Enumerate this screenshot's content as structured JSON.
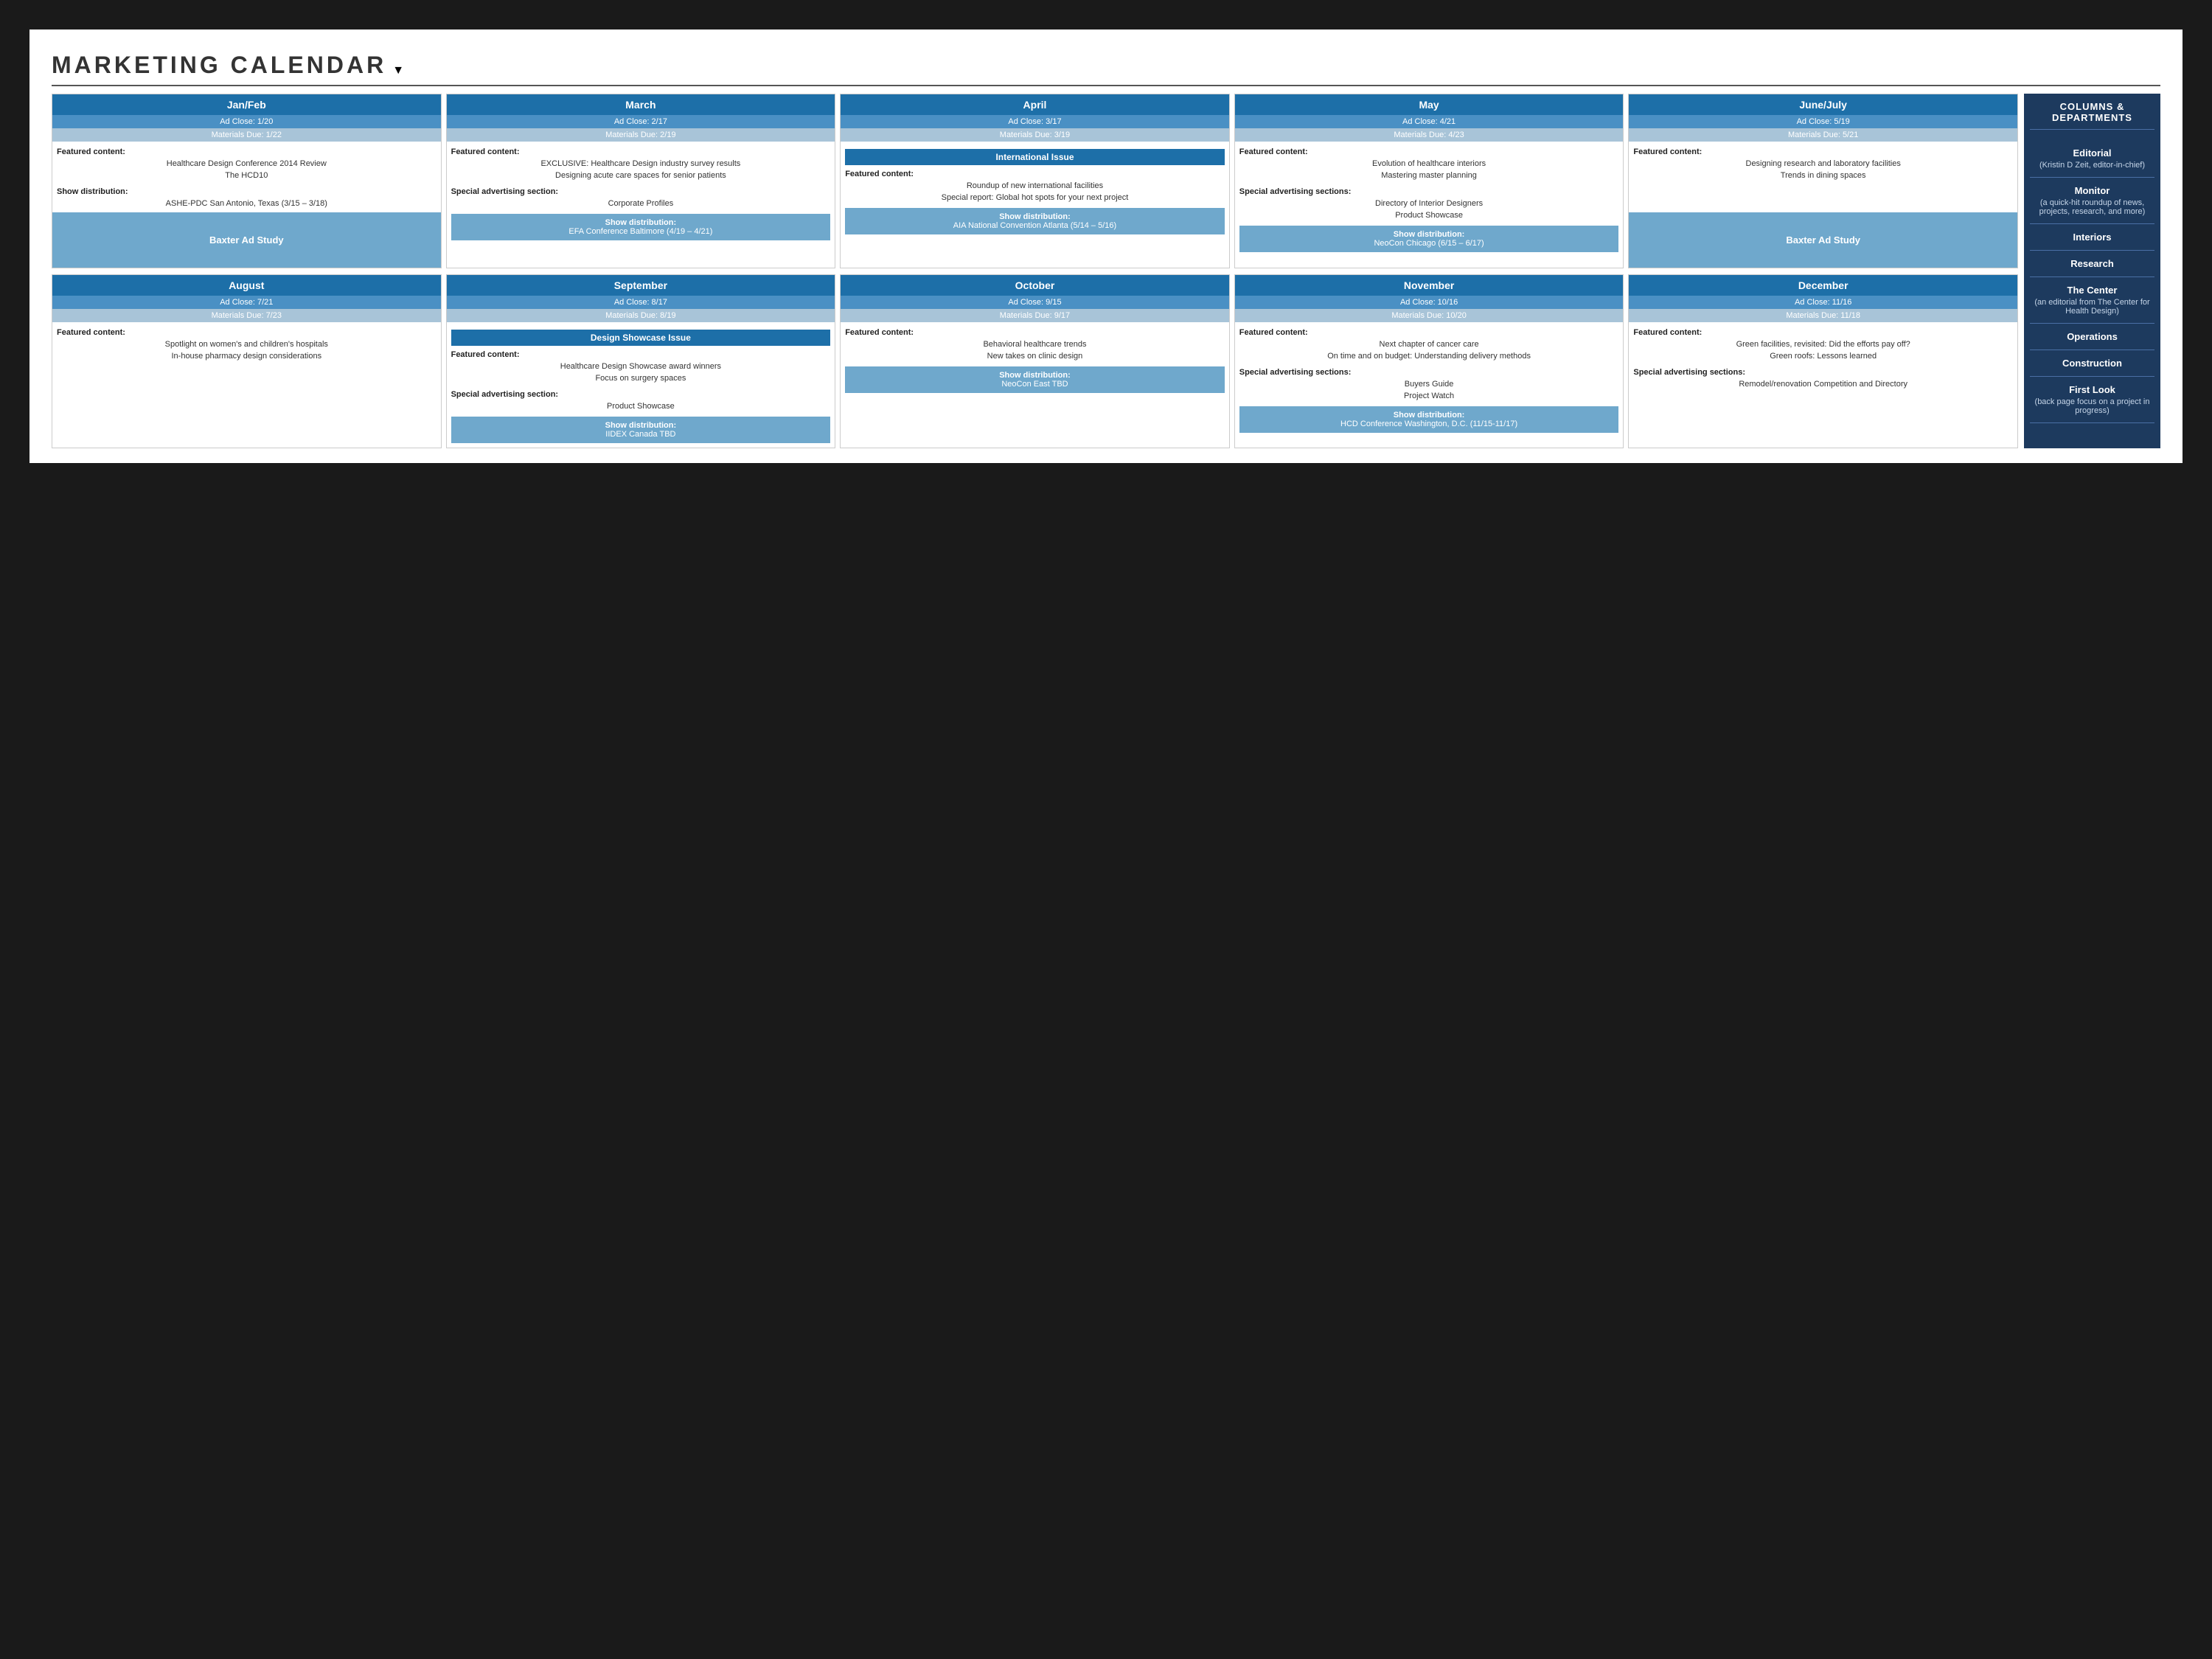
{
  "header": {
    "title": "MARKETING CALENDAR"
  },
  "sidebar": {
    "title": "COLUMNS & DEPARTMENTS",
    "items": [
      {
        "name": "Editorial",
        "desc": "(Kristin D Zeit, editor-in-chief)"
      },
      {
        "name": "Monitor",
        "desc": "(a quick-hit roundup of news, projects, research, and more)"
      },
      {
        "name": "Interiors",
        "desc": ""
      },
      {
        "name": "Research",
        "desc": ""
      },
      {
        "name": "The Center",
        "desc": "(an editorial from The Center for Health Design)"
      },
      {
        "name": "Operations",
        "desc": ""
      },
      {
        "name": "Construction",
        "desc": ""
      },
      {
        "name": "First Look",
        "desc": "(back page focus on a project in progress)"
      }
    ]
  },
  "rows": [
    {
      "months": [
        {
          "id": "jan-feb",
          "name": "Jan/Feb",
          "ad_close": "Ad Close: 1/20",
          "materials_due": "Materials Due: 1/22",
          "featured_label": "Featured content:",
          "featured_items": [
            "Healthcare Design Conference 2014 Review",
            "The HCD10"
          ],
          "special_label": "Show distribution:",
          "special_items": [
            "ASHE-PDC San Antonio, Texas (3/15 – 3/18)"
          ],
          "bottom_box": "Baxter Ad Study",
          "bottom_box_type": "baxter"
        },
        {
          "id": "march",
          "name": "March",
          "ad_close": "Ad Close: 2/17",
          "materials_due": "Materials Due: 2/19",
          "featured_label": "Featured content:",
          "featured_items": [
            "EXCLUSIVE: Healthcare Design industry survey results",
            "Designing acute care spaces for senior patients"
          ],
          "special_label": "Special advertising section:",
          "special_items": [
            "Corporate Profiles"
          ],
          "show_label": "Show distribution:",
          "show_items": [
            "EFA Conference Baltimore (4/19 – 4/21)"
          ],
          "bottom_box": null
        },
        {
          "id": "april",
          "name": "April",
          "ad_close": "Ad Close: 3/17",
          "materials_due": "Materials Due: 3/19",
          "highlight": "International Issue",
          "featured_label": "Featured content:",
          "featured_items": [
            "Roundup of new international facilities",
            "Special report: Global hot spots for your next project"
          ],
          "show_label": "Show distribution:",
          "show_items": [
            "AIA National Convention Atlanta (5/14 – 5/16)"
          ],
          "bottom_box": null
        },
        {
          "id": "may",
          "name": "May",
          "ad_close": "Ad Close: 4/21",
          "materials_due": "Materials Due: 4/23",
          "featured_label": "Featured content:",
          "featured_items": [
            "Evolution of healthcare interiors",
            "Mastering master planning"
          ],
          "special_label": "Special advertising sections:",
          "special_items": [
            "Directory of Interior Designers",
            "Product Showcase"
          ],
          "show_label": "Show distribution:",
          "show_items": [
            "NeoCon Chicago (6/15 – 6/17)"
          ],
          "bottom_box": null
        },
        {
          "id": "june-july",
          "name": "June/July",
          "ad_close": "Ad Close: 5/19",
          "materials_due": "Materials Due: 5/21",
          "featured_label": "Featured content:",
          "featured_items": [
            "Designing research and laboratory facilities",
            "Trends in dining spaces"
          ],
          "special_label": null,
          "special_items": [],
          "show_label": null,
          "show_items": [],
          "bottom_box": "Baxter Ad Study",
          "bottom_box_type": "baxter"
        }
      ]
    },
    {
      "months": [
        {
          "id": "august",
          "name": "August",
          "ad_close": "Ad Close: 7/21",
          "materials_due": "Materials Due: 7/23",
          "featured_label": "Featured content:",
          "featured_items": [
            "Spotlight on women's and children's hospitals",
            "In-house pharmacy design considerations"
          ],
          "special_label": null,
          "special_items": [],
          "show_label": null,
          "show_items": [],
          "bottom_box": null
        },
        {
          "id": "september",
          "name": "September",
          "ad_close": "Ad Close: 8/17",
          "materials_due": "Materials Due: 8/19",
          "highlight": "Design Showcase Issue",
          "featured_label": "Featured content:",
          "featured_items": [
            "Healthcare Design Showcase award winners",
            "Focus on surgery spaces"
          ],
          "special_label": "Special advertising section:",
          "special_items": [
            "Product Showcase"
          ],
          "show_label": "Show distribution:",
          "show_items": [
            "IIDEX Canada TBD"
          ],
          "bottom_box": null
        },
        {
          "id": "october",
          "name": "October",
          "ad_close": "Ad Close: 9/15",
          "materials_due": "Materials Due: 9/17",
          "featured_label": "Featured content:",
          "featured_items": [
            "Behavioral healthcare trends",
            "New takes on clinic design"
          ],
          "show_label": "Show distribution:",
          "show_items": [
            "NeoCon East TBD"
          ],
          "bottom_box": null
        },
        {
          "id": "november",
          "name": "November",
          "ad_close": "Ad Close: 10/16",
          "materials_due": "Materials Due: 10/20",
          "featured_label": "Featured content:",
          "featured_items": [
            "Next chapter of cancer care",
            "On time and on budget: Understanding delivery methods"
          ],
          "special_label": "Special advertising sections:",
          "special_items": [
            "Buyers Guide",
            "Project Watch"
          ],
          "show_label": "Show distribution:",
          "show_items": [
            "HCD Conference Washington, D.C. (11/15-11/17)"
          ],
          "bottom_box": null
        },
        {
          "id": "december",
          "name": "December",
          "ad_close": "Ad Close: 11/16",
          "materials_due": "Materials Due: 11/18",
          "featured_label": "Featured content:",
          "featured_items": [
            "Green facilities, revisited: Did the efforts pay off?",
            "Green roofs: Lessons learned"
          ],
          "special_label": "Special advertising sections:",
          "special_items": [
            "Remodel/renovation Competition and Directory"
          ],
          "show_label": null,
          "show_items": [],
          "bottom_box": null
        }
      ]
    }
  ]
}
